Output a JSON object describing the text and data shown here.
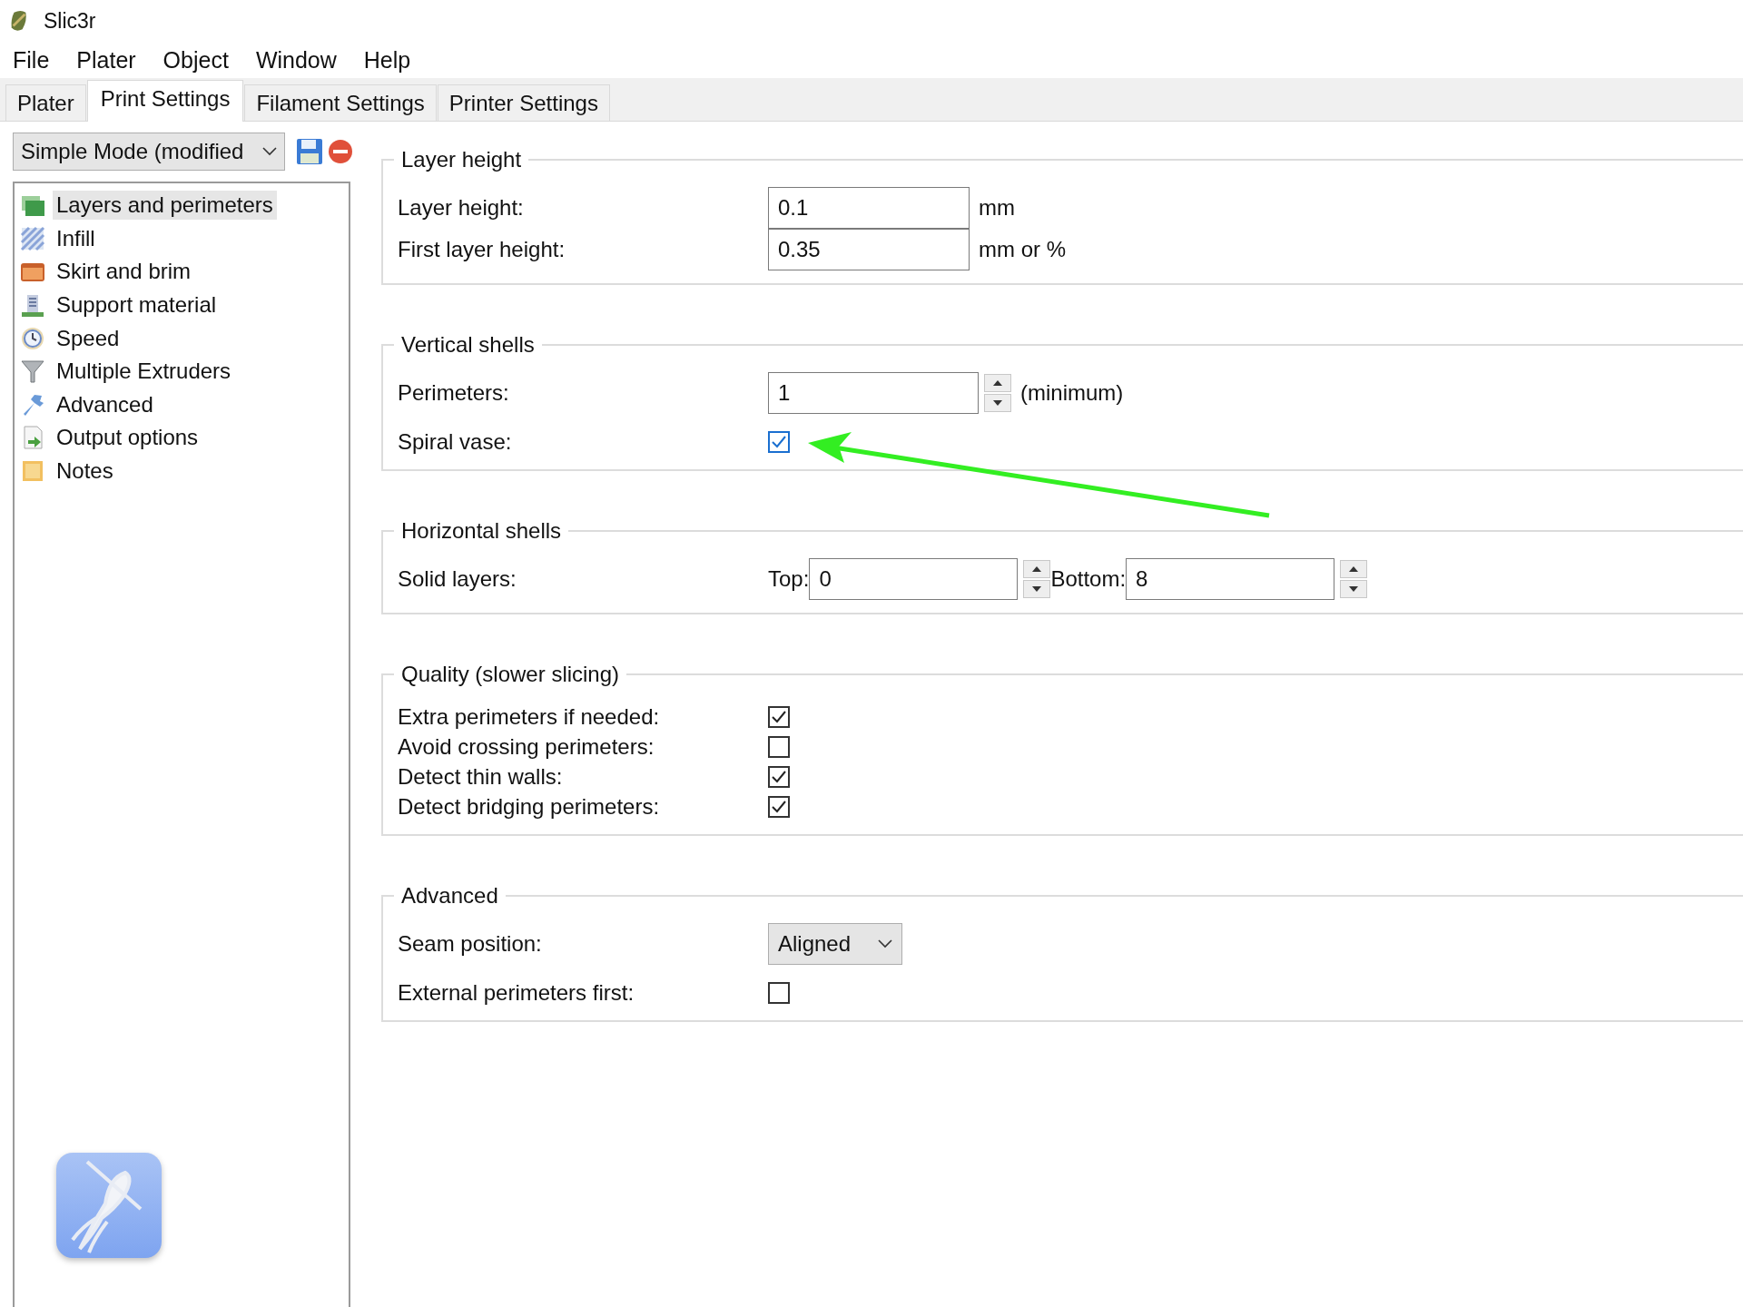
{
  "window": {
    "title": "Slic3r"
  },
  "menu": [
    "File",
    "Plater",
    "Object",
    "Window",
    "Help"
  ],
  "tabs": [
    {
      "label": "Plater",
      "selected": false
    },
    {
      "label": "Print Settings",
      "selected": true
    },
    {
      "label": "Filament Settings",
      "selected": false
    },
    {
      "label": "Printer Settings",
      "selected": false
    }
  ],
  "preset": {
    "value": "Simple Mode (modified"
  },
  "sidebar": {
    "items": [
      {
        "label": "Layers and perimeters",
        "selected": true
      },
      {
        "label": "Infill",
        "selected": false
      },
      {
        "label": "Skirt and brim",
        "selected": false
      },
      {
        "label": "Support material",
        "selected": false
      },
      {
        "label": "Speed",
        "selected": false
      },
      {
        "label": "Multiple Extruders",
        "selected": false
      },
      {
        "label": "Advanced",
        "selected": false
      },
      {
        "label": "Output options",
        "selected": false
      },
      {
        "label": "Notes",
        "selected": false
      }
    ]
  },
  "groups": [
    {
      "title": "Layer height",
      "rows": [
        {
          "kind": "text",
          "label": "Layer height:",
          "value": "0.1",
          "unit": "mm"
        },
        {
          "kind": "text",
          "label": "First layer height:",
          "value": "0.35",
          "unit": "mm or %"
        }
      ]
    },
    {
      "title": "Vertical shells",
      "rows": [
        {
          "kind": "spin",
          "label": "Perimeters:",
          "value": "1",
          "unit": "(minimum)"
        },
        {
          "kind": "checkbox",
          "label": "Spiral vase:",
          "checked": true,
          "focused": true
        }
      ]
    },
    {
      "title": "Horizontal shells",
      "rows": [
        {
          "kind": "pair",
          "label": "Solid layers:",
          "top_label": "Top:",
          "top_value": "0",
          "bottom_label": "Bottom:",
          "bottom_value": "8"
        }
      ]
    },
    {
      "title": "Quality (slower slicing)",
      "rows": [
        {
          "kind": "checkbox",
          "label": "Extra perimeters if needed:",
          "checked": true,
          "focused": false
        },
        {
          "kind": "checkbox",
          "label": "Avoid crossing perimeters:",
          "checked": false,
          "focused": false
        },
        {
          "kind": "checkbox",
          "label": "Detect thin walls:",
          "checked": true,
          "focused": false
        },
        {
          "kind": "checkbox",
          "label": "Detect bridging perimeters:",
          "checked": true,
          "focused": false
        }
      ]
    },
    {
      "title": "Advanced",
      "rows": [
        {
          "kind": "select",
          "label": "Seam position:",
          "value": "Aligned"
        },
        {
          "kind": "checkbox",
          "label": "External perimeters first:",
          "checked": false,
          "focused": false
        }
      ]
    }
  ]
}
